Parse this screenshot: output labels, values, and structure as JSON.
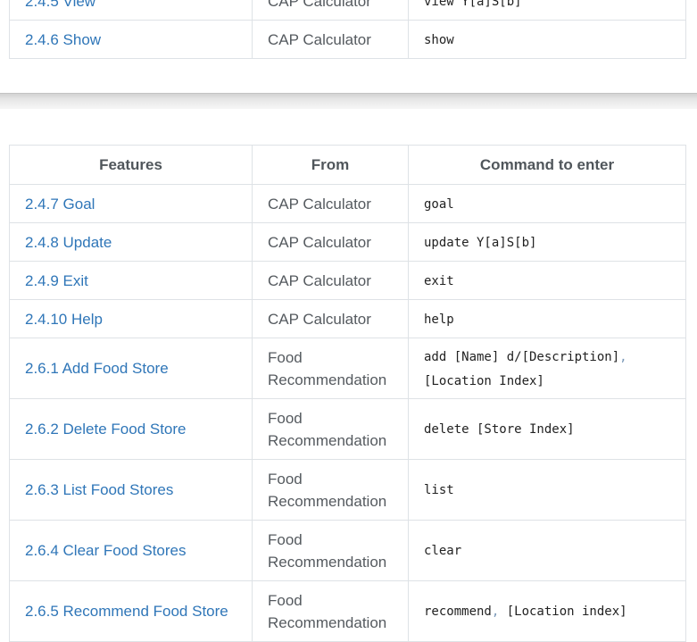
{
  "top_table": {
    "rows": [
      {
        "feature": "2.4.5 View",
        "from": "CAP Calculator",
        "command": [
          {
            "text": "view Y[a]S[b]",
            "sep": false
          }
        ]
      },
      {
        "feature": "2.4.6 Show",
        "from": "CAP Calculator",
        "command": [
          {
            "text": "show",
            "sep": false
          }
        ]
      }
    ]
  },
  "main_table": {
    "headers": {
      "features": "Features",
      "from": "From",
      "command": "Command to enter"
    },
    "rows": [
      {
        "feature": "2.4.7 Goal",
        "from": "CAP Calculator",
        "command": [
          {
            "text": "goal",
            "sep": false
          }
        ]
      },
      {
        "feature": "2.4.8 Update",
        "from": "CAP Calculator",
        "command": [
          {
            "text": "update Y[a]S[b]",
            "sep": false
          }
        ]
      },
      {
        "feature": "2.4.9 Exit",
        "from": "CAP Calculator",
        "command": [
          {
            "text": "exit",
            "sep": false
          }
        ]
      },
      {
        "feature": "2.4.10 Help",
        "from": "CAP Calculator",
        "command": [
          {
            "text": "help",
            "sep": false
          }
        ]
      },
      {
        "feature": "2.6.1 Add Food Store",
        "from": "Food Recommendation",
        "command": [
          {
            "text": "add [Name] d/[Description]",
            "sep": false
          },
          {
            "text": ", ",
            "sep": true
          },
          {
            "text": "[Location Index]",
            "sep": false
          }
        ]
      },
      {
        "feature": "2.6.2 Delete Food Store",
        "from": "Food Recommendation",
        "command": [
          {
            "text": "delete [Store Index]",
            "sep": false
          }
        ]
      },
      {
        "feature": "2.6.3 List Food Stores",
        "from": "Food Recommendation",
        "command": [
          {
            "text": "list",
            "sep": false
          }
        ]
      },
      {
        "feature": "2.6.4 Clear Food Stores",
        "from": "Food Recommendation",
        "command": [
          {
            "text": "clear",
            "sep": false
          }
        ]
      },
      {
        "feature": "2.6.5 Recommend Food Store",
        "from": "Food Recommendation",
        "command": [
          {
            "text": "recommend",
            "sep": false
          },
          {
            "text": ", ",
            "sep": true
          },
          {
            "text": "[Location index]",
            "sep": false
          }
        ]
      }
    ]
  }
}
